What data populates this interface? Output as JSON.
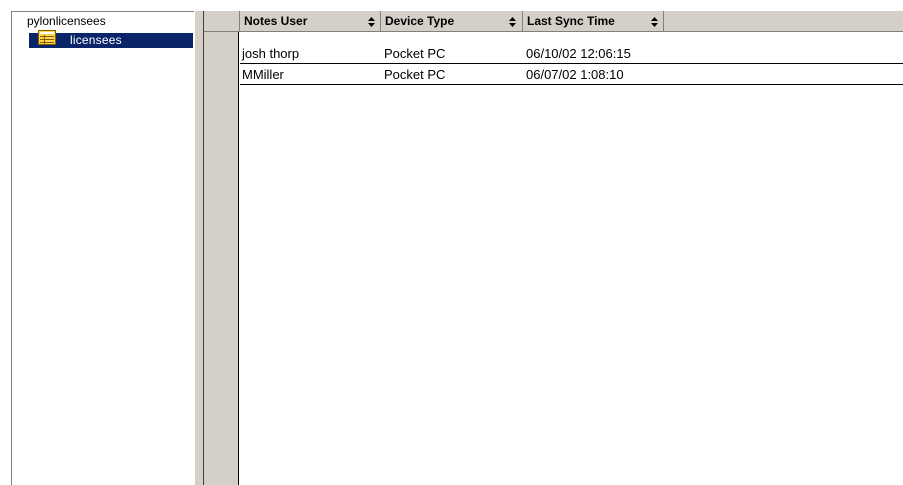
{
  "tree": {
    "root_label": "pylonlicensees",
    "child_label": "licensees"
  },
  "grid": {
    "columns": [
      "Notes User",
      "Device Type",
      "Last Sync Time"
    ],
    "rows": [
      [
        "josh thorp",
        "Pocket PC",
        "06/10/02 12:06:15"
      ],
      [
        "MMiller",
        "Pocket PC",
        "06/07/02 1:08:10"
      ]
    ]
  },
  "colors": {
    "selection": "#0a246a",
    "chrome": "#d4d0c8",
    "folder_icon": "#ffd44a"
  }
}
